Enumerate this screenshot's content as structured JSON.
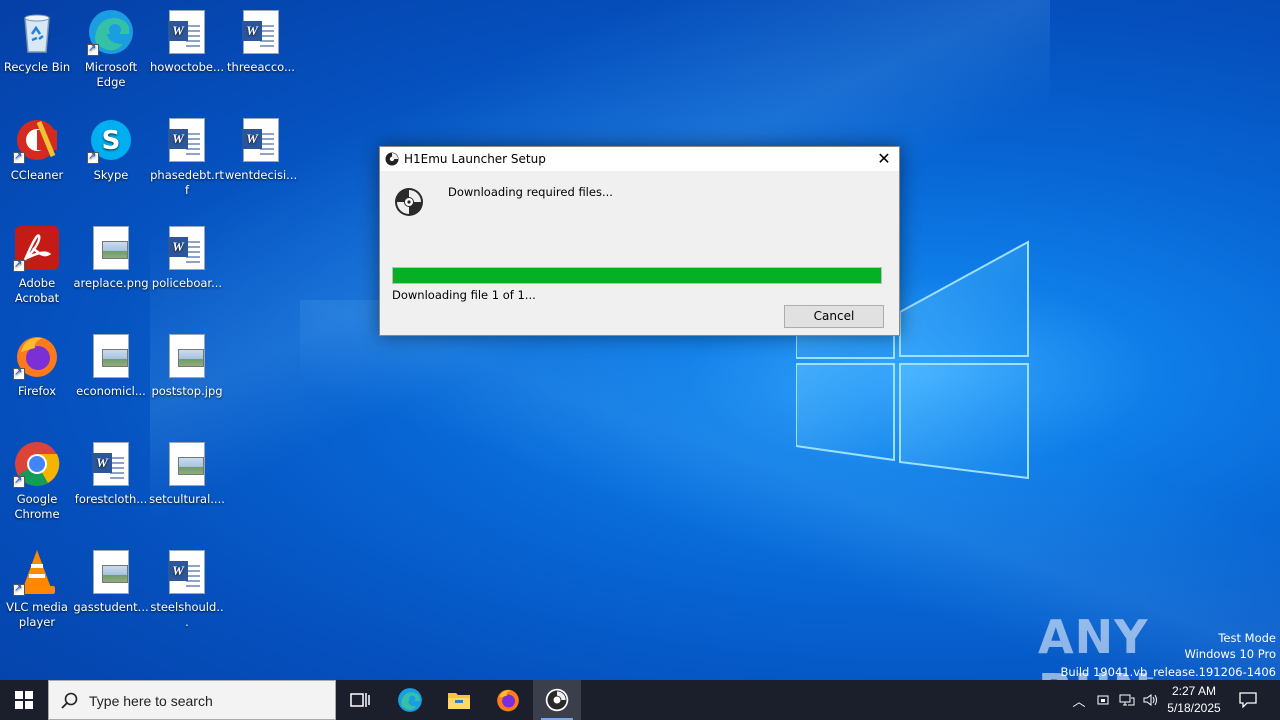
{
  "desktop": {
    "icons": [
      {
        "label": "Recycle Bin",
        "icon": "recycle-bin-icon"
      },
      {
        "label": "Microsoft Edge",
        "icon": "edge-icon"
      },
      {
        "label": "howoctobe...",
        "icon": "word-doc-icon"
      },
      {
        "label": "threeacco...",
        "icon": "word-doc-icon"
      },
      {
        "label": "CCleaner",
        "icon": "ccleaner-icon"
      },
      {
        "label": "Skype",
        "icon": "skype-icon"
      },
      {
        "label": "phasedebt.rtf",
        "icon": "word-doc-icon"
      },
      {
        "label": "wentdecisi...",
        "icon": "word-doc-icon"
      },
      {
        "label": "Adobe Acrobat",
        "icon": "acrobat-icon"
      },
      {
        "label": "areplace.png",
        "icon": "image-file-icon"
      },
      {
        "label": "policeboar...",
        "icon": "word-doc-icon"
      },
      {
        "label": "Firefox",
        "icon": "firefox-icon"
      },
      {
        "label": "economicl...",
        "icon": "image-file-icon"
      },
      {
        "label": "poststop.jpg",
        "icon": "image-file-icon"
      },
      {
        "label": "Google Chrome",
        "icon": "chrome-icon"
      },
      {
        "label": "forestcloth...",
        "icon": "word-doc-icon"
      },
      {
        "label": "setcultural....",
        "icon": "image-file-icon"
      },
      {
        "label": "VLC media player",
        "icon": "vlc-icon"
      },
      {
        "label": "gasstudent...",
        "icon": "image-file-icon"
      },
      {
        "label": "steelshould...",
        "icon": "word-doc-icon"
      }
    ]
  },
  "dialog": {
    "title": "H1Emu Launcher Setup",
    "message": "Downloading required files...",
    "progress_fraction": 1.0,
    "status": "Downloading file 1 of 1...",
    "cancel_label": "Cancel"
  },
  "watermark": {
    "brand": "ANY RUN",
    "line1": "Test Mode",
    "line2": "Windows 10 Pro",
    "line3": "Build 19041.vb_release.191206-1406"
  },
  "taskbar": {
    "search_placeholder": "Type here to search",
    "time": "2:27 AM",
    "date": "5/18/2025"
  },
  "colors": {
    "progress_fill": "#06b025",
    "taskbar_bg": "#1a1f2b",
    "desktop_blue": "#0868d6"
  }
}
